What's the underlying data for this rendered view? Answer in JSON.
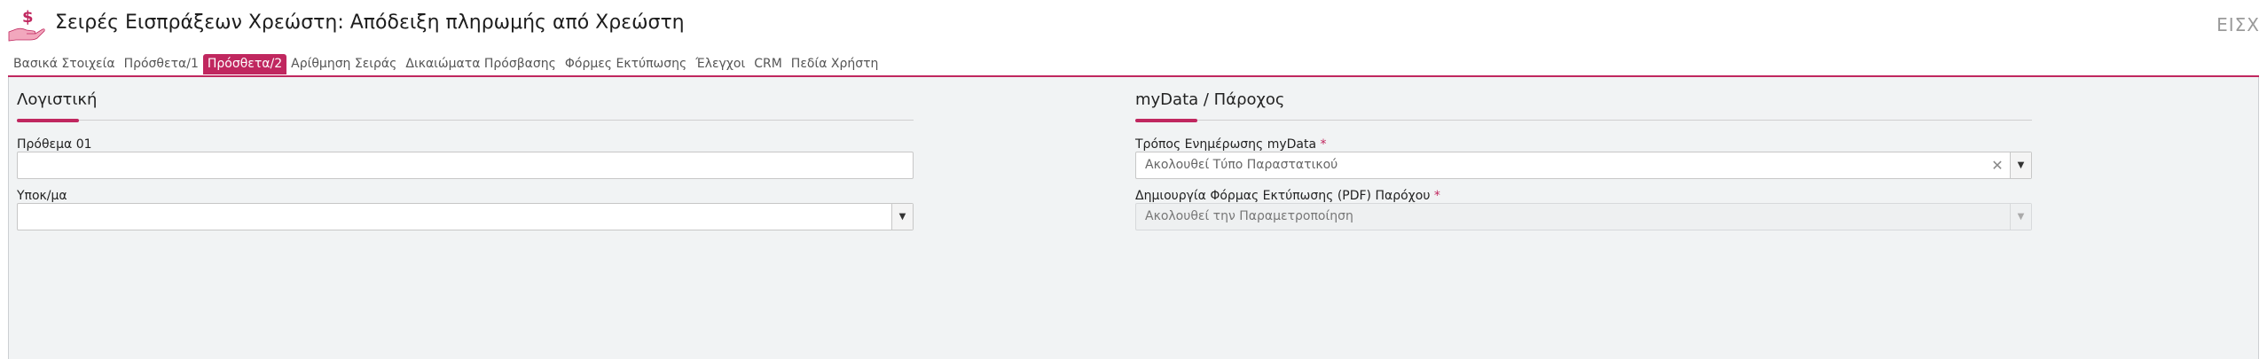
{
  "header": {
    "title": "Σειρές Εισπράξεων Χρεώστη: Απόδειξη πληρωμής από Χρεώστη",
    "code": "ΕΙΣΧ",
    "logo_icon": "hand-money-icon",
    "accent_color": "#c0275f"
  },
  "tabs": [
    {
      "label": "Βασικά Στοιχεία",
      "active": false
    },
    {
      "label": "Πρόσθετα/1",
      "active": false
    },
    {
      "label": "Πρόσθετα/2",
      "active": true
    },
    {
      "label": "Αρίθμηση Σειράς",
      "active": false
    },
    {
      "label": "Δικαιώματα Πρόσβασης",
      "active": false
    },
    {
      "label": "Φόρμες Εκτύπωσης",
      "active": false
    },
    {
      "label": "Έλεγχοι",
      "active": false
    },
    {
      "label": "CRM",
      "active": false
    },
    {
      "label": "Πεδία Χρήστη",
      "active": false
    }
  ],
  "left_section": {
    "title": "Λογιστική",
    "fields": {
      "prefix_label": "Πρόθεμα 01",
      "prefix_value": "",
      "branch_label": "Υποκ/μα",
      "branch_value": ""
    }
  },
  "right_section": {
    "title": "myData / Πάροχος",
    "fields": {
      "mydata_label": "Τρόπος Ενημέρωσης myData",
      "mydata_value": "Ακολουθεί Τύπο Παραστατικού",
      "pdf_label": "Δημιουργία Φόρμας Εκτύπωσης (PDF) Παρόχου",
      "pdf_value": "Ακολουθεί την Παραμετροποίηση",
      "required_mark": "*"
    }
  }
}
